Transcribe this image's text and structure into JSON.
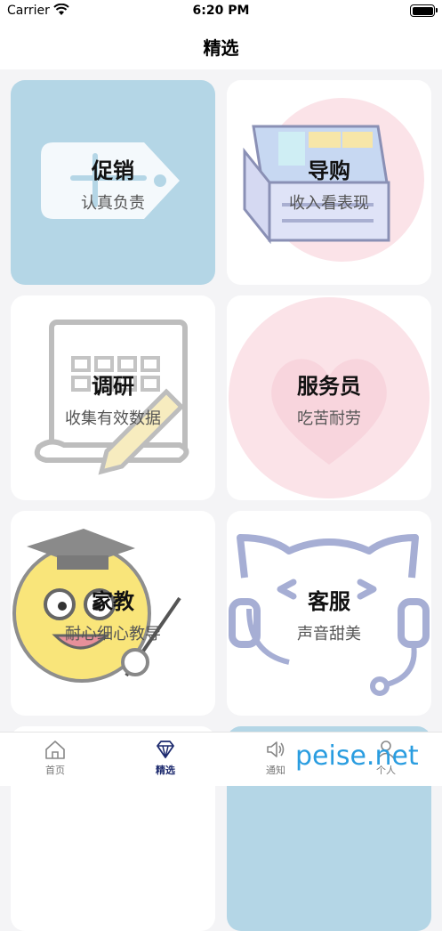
{
  "status": {
    "carrier": "Carrier",
    "time": "6:20 PM"
  },
  "nav": {
    "title": "精选"
  },
  "cards": [
    {
      "title": "促销",
      "subtitle": "认真负责"
    },
    {
      "title": "导购",
      "subtitle": "收入看表现"
    },
    {
      "title": "调研",
      "subtitle": "收集有效数据"
    },
    {
      "title": "服务员",
      "subtitle": "吃苦耐劳"
    },
    {
      "title": "家教",
      "subtitle": "耐心细心教导"
    },
    {
      "title": "客服",
      "subtitle": "声音甜美"
    }
  ],
  "tabs": [
    {
      "label": "首页",
      "icon": "home-icon"
    },
    {
      "label": "精选",
      "icon": "diamond-icon",
      "active": true
    },
    {
      "label": "通知",
      "icon": "speaker-icon"
    },
    {
      "label": "个人",
      "icon": "person-icon"
    }
  ],
  "watermark": "peise.net",
  "colors": {
    "card_blue": "#b4d6e6",
    "active_tab": "#1d2a6e",
    "watermark": "#2a9de0"
  }
}
